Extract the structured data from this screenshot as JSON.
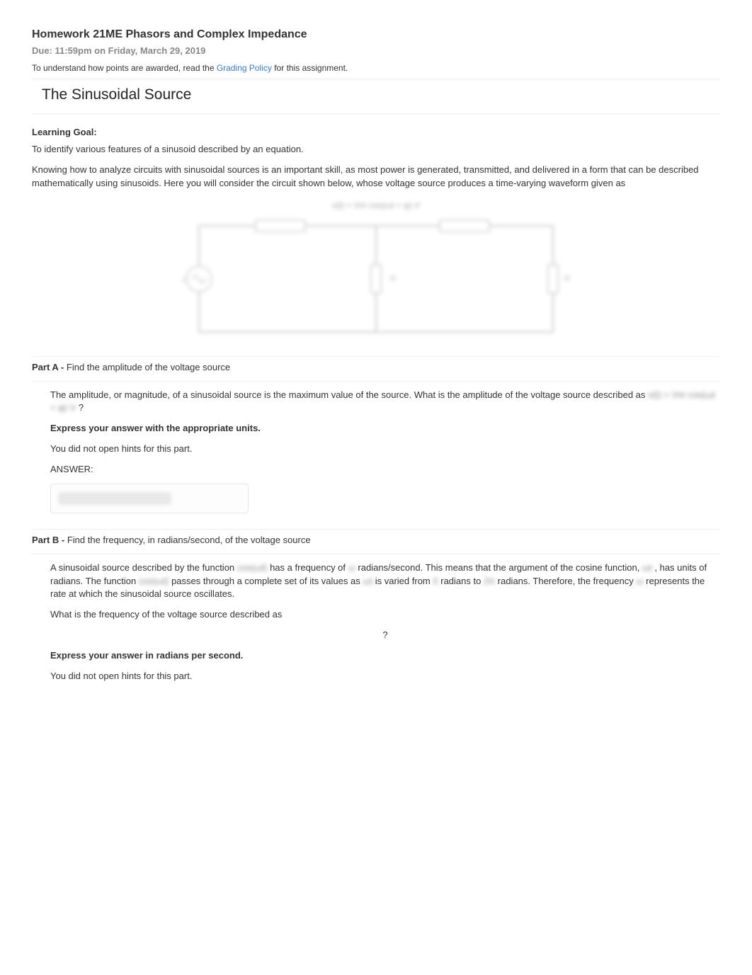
{
  "header": {
    "title": "Homework 21ME Phasors and Complex Impedance",
    "due": "Due: 11:59pm on Friday, March 29, 2019",
    "policy_prefix": "To understand how points are awarded, read the ",
    "policy_link": "Grading Policy",
    "policy_suffix": " for this assignment."
  },
  "section": {
    "title": "The Sinusoidal Source"
  },
  "learning_goal": {
    "heading": "Learning Goal:",
    "text": "To identify various features of a sinusoid described by an equation."
  },
  "intro": "Knowing how to analyze circuits with sinusoidal sources is an important skill, as most power is generated, transmitted, and delivered in a form that can be described mathematically using sinusoids.  Here you will consider the circuit shown below, whose voltage source produces a time-varying waveform given as",
  "partA": {
    "label_prefix": "Part A - ",
    "label": "Find the amplitude of the voltage source",
    "desc_prefix": "The amplitude, or magnitude, of a sinusoidal source is the maximum value of the source.  What is the amplitude of the voltage source described as ",
    "desc_suffix": " ?",
    "express": "Express your answer with the appropriate units.",
    "hint": "You did not open hints for this part.",
    "answer_label": "ANSWER:"
  },
  "partB": {
    "label_prefix": "Part B - ",
    "label": "Find the frequency, in radians/second, of the voltage source",
    "desc1_a": "A sinusoidal source described by the function ",
    "desc1_b": " has a frequency of ",
    "desc1_c": " radians/second.  This means that the argument of the cosine function, ",
    "desc1_d": " , has units of radians.  The function ",
    "desc1_e": " passes through a complete set of its values as ",
    "desc1_f": " is varied from ",
    "desc1_g": " radians to ",
    "desc2": "radians.  Therefore, the frequency ",
    "desc2_b": " represents the rate at which the sinusoidal source oscillates.",
    "question": "What is the frequency of the voltage source described as",
    "qmark": "?",
    "express": "Express your answer in radians per second.",
    "hint": "You did not open hints for this part."
  }
}
